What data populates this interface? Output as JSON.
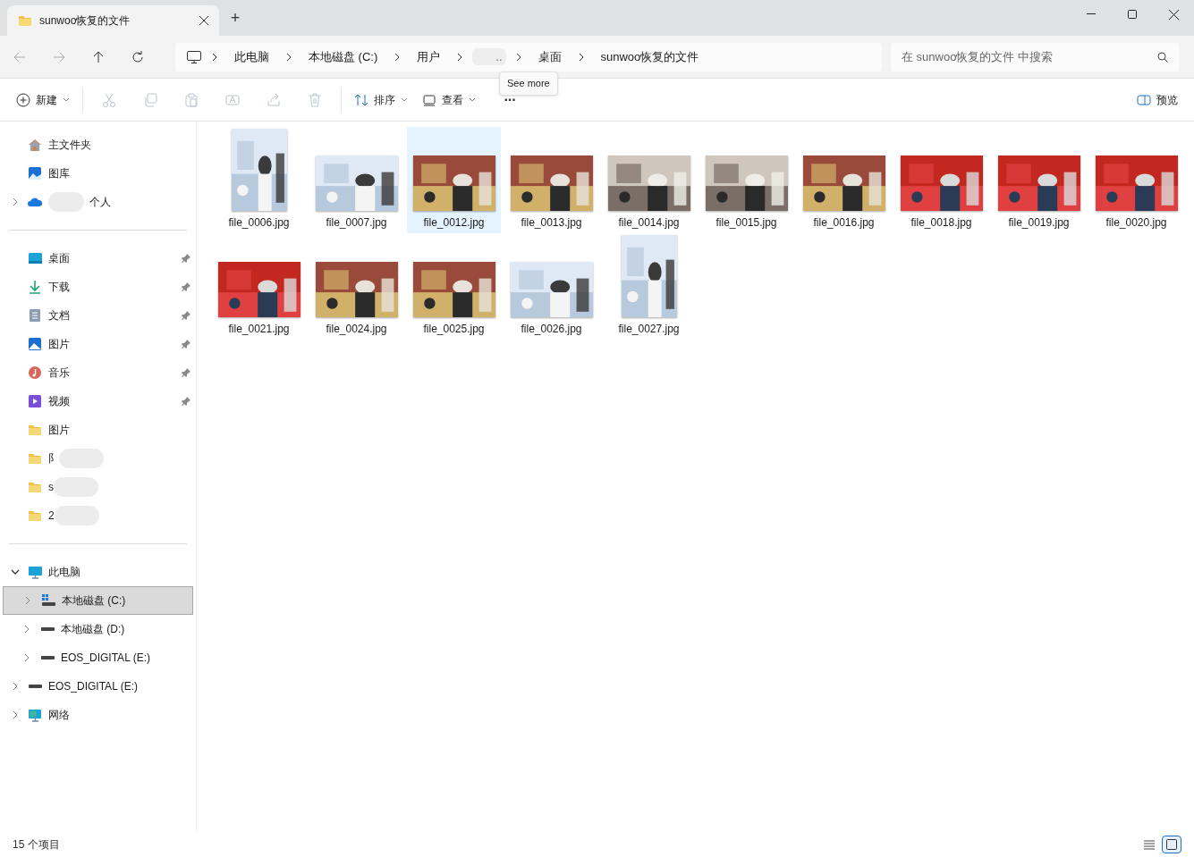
{
  "window": {
    "tab_title": "sunwoo恢复的文件",
    "new_tab": "+"
  },
  "breadcrumb": [
    {
      "label": "此电脑"
    },
    {
      "label": "本地磁盘 (C:)"
    },
    {
      "label": "用户"
    },
    {
      "label": "..",
      "redacted": true
    },
    {
      "label": "桌面"
    },
    {
      "label": "sunwoo恢复的文件"
    }
  ],
  "search": {
    "placeholder": "在 sunwoo恢复的文件 中搜索"
  },
  "toolbar": [
    {
      "kind": "new",
      "label": "新建"
    },
    {
      "kind": "cut",
      "disabled": true
    },
    {
      "kind": "copy",
      "disabled": true
    },
    {
      "kind": "paste",
      "disabled": true
    },
    {
      "kind": "rename",
      "disabled": true
    },
    {
      "kind": "share",
      "disabled": true
    },
    {
      "kind": "delete",
      "disabled": true
    },
    {
      "kind": "sort",
      "label": "排序"
    },
    {
      "kind": "view",
      "label": "查看"
    },
    {
      "kind": "more",
      "label": "···"
    },
    {
      "kind": "preview",
      "label": "预览"
    }
  ],
  "tooltip": "See more",
  "sidebar": {
    "groups": [
      [
        {
          "kind": "home",
          "label": "主文件夹"
        },
        {
          "kind": "gallery",
          "label": "图库"
        },
        {
          "kind": "cloud",
          "label": "个人",
          "redacted": true,
          "expanded": false
        }
      ],
      [
        {
          "kind": "desktop",
          "label": "桌面",
          "pinned": true
        },
        {
          "kind": "download",
          "label": "下载",
          "pinned": true
        },
        {
          "kind": "document",
          "label": "文档",
          "pinned": true
        },
        {
          "kind": "picture",
          "label": "图片",
          "pinned": true
        },
        {
          "kind": "music",
          "label": "音乐",
          "pinned": true
        },
        {
          "kind": "video",
          "label": "视频",
          "pinned": true
        },
        {
          "kind": "folder",
          "label": "图片"
        },
        {
          "kind": "folder",
          "label": "阝",
          "redacted": true
        },
        {
          "kind": "folder",
          "label": "s",
          "redacted": true
        },
        {
          "kind": "folder",
          "label": "2",
          "redacted": true
        }
      ],
      [
        {
          "kind": "pc",
          "label": "此电脑",
          "expanded": true,
          "selected": false,
          "children": [
            {
              "kind": "windrive",
              "label": "本地磁盘 (C:)",
              "expanded": false,
              "selected": true
            },
            {
              "kind": "drive",
              "label": "本地磁盘 (D:)",
              "expanded": false,
              "selected": false
            },
            {
              "kind": "drive",
              "label": "EOS_DIGITAL (E:)",
              "expanded": false,
              "selected": false
            }
          ]
        },
        {
          "kind": "drive",
          "label": "EOS_DIGITAL (E:)",
          "expanded": false,
          "selected": false
        },
        {
          "kind": "network",
          "label": "网络",
          "expanded": false,
          "selected": false
        }
      ]
    ]
  },
  "files": [
    {
      "name": "file_0006.jpg",
      "selected": false
    },
    {
      "name": "file_0007.jpg",
      "selected": false
    },
    {
      "name": "file_0012.jpg",
      "selected": true
    },
    {
      "name": "file_0013.jpg",
      "selected": false
    },
    {
      "name": "file_0014.jpg",
      "selected": false
    },
    {
      "name": "file_0015.jpg",
      "selected": false
    },
    {
      "name": "file_0016.jpg",
      "selected": false
    },
    {
      "name": "file_0018.jpg",
      "selected": false
    },
    {
      "name": "file_0019.jpg",
      "selected": false
    },
    {
      "name": "file_0020.jpg",
      "selected": false
    },
    {
      "name": "file_0021.jpg",
      "selected": false
    },
    {
      "name": "file_0024.jpg",
      "selected": false
    },
    {
      "name": "file_0025.jpg",
      "selected": false
    },
    {
      "name": "file_0026.jpg",
      "selected": false
    },
    {
      "name": "file_0027.jpg",
      "selected": false
    }
  ],
  "status_bar": {
    "count": "15 个项目",
    "view_buttons": [
      {
        "kind": "details",
        "selected": false
      },
      {
        "kind": "icons",
        "selected": true
      }
    ]
  }
}
